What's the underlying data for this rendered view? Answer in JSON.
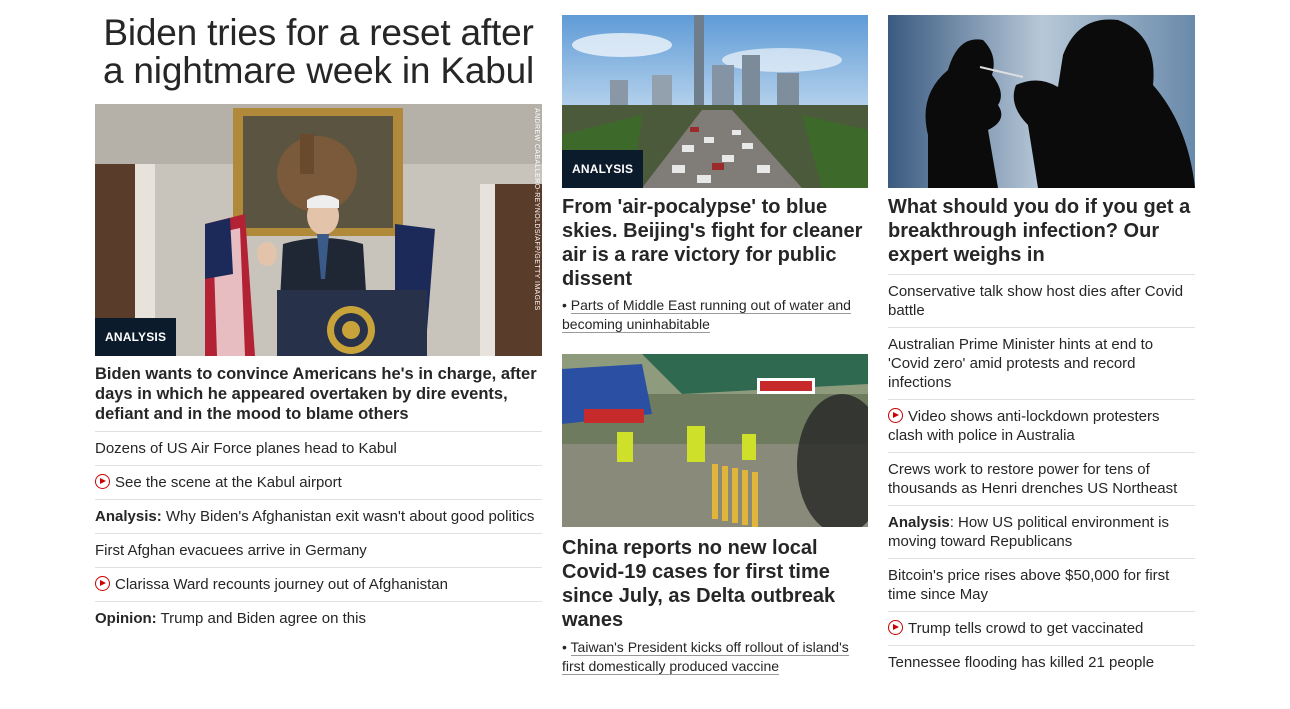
{
  "left": {
    "banner_title": "Biden tries for a reset after a nightmare week in Kabul",
    "image_tag": "ANALYSIS",
    "image_credit": "ANDREW CABALLERO-REYNOLDS/AFP/GETTY IMAGES",
    "headline": "Biden wants to convince Americans he's in charge, after days in which he appeared overtaken by dire events, defiant and in the mood to blame others",
    "items": [
      {
        "prefix": "",
        "text": "Dozens of US Air Force planes head to Kabul",
        "video": false
      },
      {
        "prefix": "",
        "text": "See the scene at the Kabul airport",
        "video": true
      },
      {
        "prefix": "Analysis:",
        "text": " Why Biden's Afghanistan exit wasn't about good politics",
        "video": false
      },
      {
        "prefix": "",
        "text": "First Afghan evacuees arrive in Germany",
        "video": false
      },
      {
        "prefix": "",
        "text": "Clarissa Ward recounts journey out of Afghanistan",
        "video": true
      },
      {
        "prefix": "Opinion:",
        "text": " Trump and Biden agree on this",
        "video": false
      }
    ]
  },
  "middle": {
    "story1": {
      "image_tag": "ANALYSIS",
      "headline": "From 'air-pocalypse' to blue skies. Beijing's fight for cleaner air is a rare victory for public dissent",
      "sub_link": "Parts of Middle East running out of water and becoming uninhabitable"
    },
    "story2": {
      "headline": "China reports no new local Covid-19 cases for first time since July, as Delta outbreak wanes",
      "sub_link": "Taiwan's President kicks off rollout of island's first domestically produced vaccine"
    }
  },
  "right": {
    "headline": "What should you do if you get a breakthrough infection? Our expert weighs in",
    "items": [
      {
        "prefix": "",
        "text": "Conservative talk show host dies after Covid battle",
        "video": false
      },
      {
        "prefix": "",
        "text": "Australian Prime Minister hints at end to 'Covid zero' amid protests and record infections",
        "video": false
      },
      {
        "prefix": "",
        "text": "Video shows anti-lockdown protesters clash with police in Australia",
        "video": true
      },
      {
        "prefix": "",
        "text": "Crews work to restore power for tens of thousands as Henri drenches US Northeast",
        "video": false
      },
      {
        "prefix": "Analysis",
        "text": ": How US political environment is moving toward Republicans",
        "video": false
      },
      {
        "prefix": "",
        "text": "Bitcoin's price rises above $50,000 for first time since May",
        "video": false
      },
      {
        "prefix": "",
        "text": "Trump tells crowd to get vaccinated",
        "video": true
      },
      {
        "prefix": "",
        "text": "Tennessee flooding has killed 21 people",
        "video": false
      }
    ]
  },
  "colors": {
    "text": "#262626",
    "tag_bg": "#0c1b2b",
    "video_icon": "#cc0000",
    "divider": "#e0e0e0"
  },
  "icons": {
    "video": "play-circle-icon"
  }
}
